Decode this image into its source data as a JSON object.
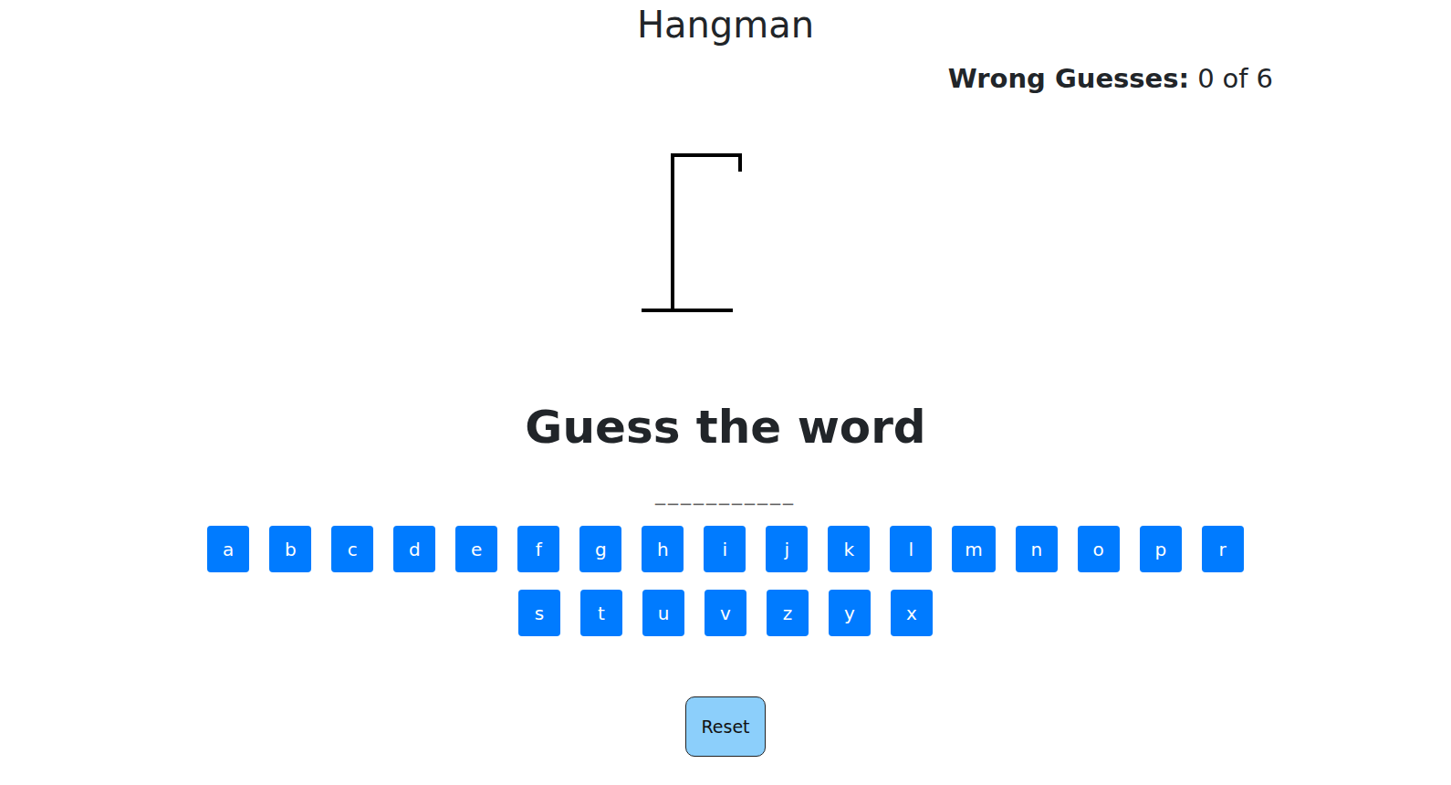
{
  "title": "Hangman",
  "wrong_guesses": {
    "label": "Wrong Guesses:",
    "count": "0",
    "separator": "of",
    "max": "6"
  },
  "hangman": {
    "parts_shown": 0
  },
  "prompt": "Guess the word",
  "word_mask": "___________",
  "keyboard_rows": [
    [
      {
        "letter": "a",
        "disabled": false
      },
      {
        "letter": "b",
        "disabled": false
      },
      {
        "letter": "c",
        "disabled": false
      },
      {
        "letter": "d",
        "disabled": false
      },
      {
        "letter": "e",
        "disabled": false
      },
      {
        "letter": "f",
        "disabled": false
      },
      {
        "letter": "g",
        "disabled": false
      },
      {
        "letter": "h",
        "disabled": false
      },
      {
        "letter": "i",
        "disabled": false
      },
      {
        "letter": "j",
        "disabled": false
      },
      {
        "letter": "k",
        "disabled": false
      },
      {
        "letter": "l",
        "disabled": false
      },
      {
        "letter": "m",
        "disabled": false
      },
      {
        "letter": "n",
        "disabled": false
      },
      {
        "letter": "o",
        "disabled": false
      },
      {
        "letter": "p",
        "disabled": false
      },
      {
        "letter": "r",
        "disabled": false
      }
    ],
    [
      {
        "letter": "s",
        "disabled": false
      },
      {
        "letter": "t",
        "disabled": false
      },
      {
        "letter": "u",
        "disabled": false
      },
      {
        "letter": "v",
        "disabled": false
      },
      {
        "letter": "z",
        "disabled": false
      },
      {
        "letter": "y",
        "disabled": false
      },
      {
        "letter": "x",
        "disabled": false
      }
    ]
  ],
  "reset_button": "Reset"
}
